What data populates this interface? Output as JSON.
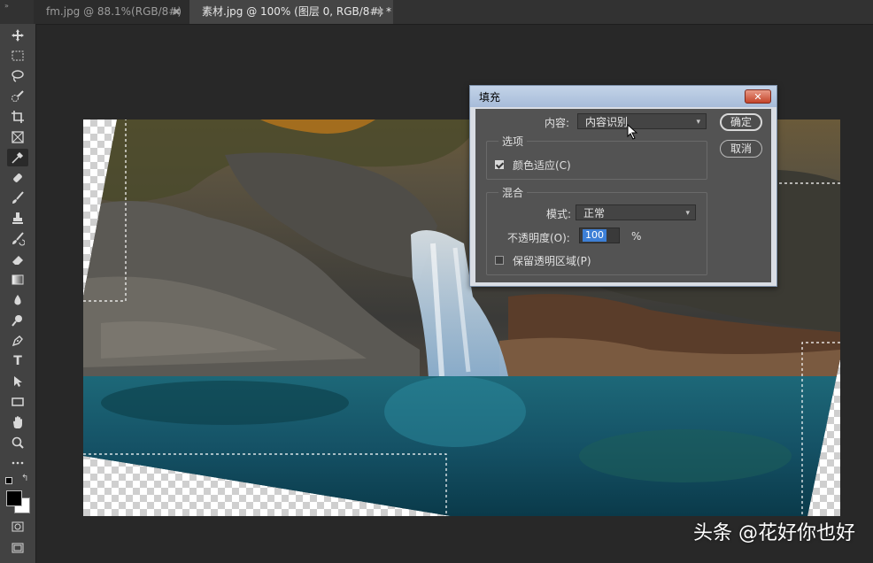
{
  "tabs": [
    {
      "label": "fm.jpg @ 88.1%(RGB/8#)",
      "close": "✖",
      "active": false
    },
    {
      "label": "素材.jpg @ 100% (图层 0, RGB/8#) *",
      "close": "✖",
      "active": true
    }
  ],
  "toolbar": {
    "collapse": "»",
    "tools": [
      "move-tool",
      "marquee-tool",
      "lasso-tool",
      "quick-select-tool",
      "crop-tool",
      "frame-tool",
      "eyedropper-tool",
      "healing-brush-tool",
      "brush-tool",
      "clone-stamp-tool",
      "history-brush-tool",
      "eraser-tool",
      "gradient-tool",
      "blur-tool",
      "dodge-tool",
      "pen-tool",
      "type-tool",
      "path-select-tool",
      "rectangle-tool",
      "hand-tool",
      "zoom-tool",
      "more-tools",
      "default-colors",
      "swap-colors",
      "foreground-color",
      "background-color",
      "quick-mask",
      "screen-mode"
    ],
    "type_glyph": "T",
    "foreground": "#000000",
    "background": "#ffffff"
  },
  "dialog": {
    "title": "填充",
    "close": "✕",
    "content_label": "内容:",
    "content_value": "内容识别",
    "options_group": "选项",
    "color_adapt_label": "颜色适应(C)",
    "color_adapt_checked": true,
    "blend_group": "混合",
    "mode_label": "模式:",
    "mode_value": "正常",
    "opacity_label": "不透明度(O):",
    "opacity_value": "100",
    "opacity_unit": "%",
    "preserve_label": "保留透明区域(P)",
    "preserve_checked": false,
    "ok": "确定",
    "cancel": "取消"
  },
  "watermark": "头条 @花好你也好"
}
